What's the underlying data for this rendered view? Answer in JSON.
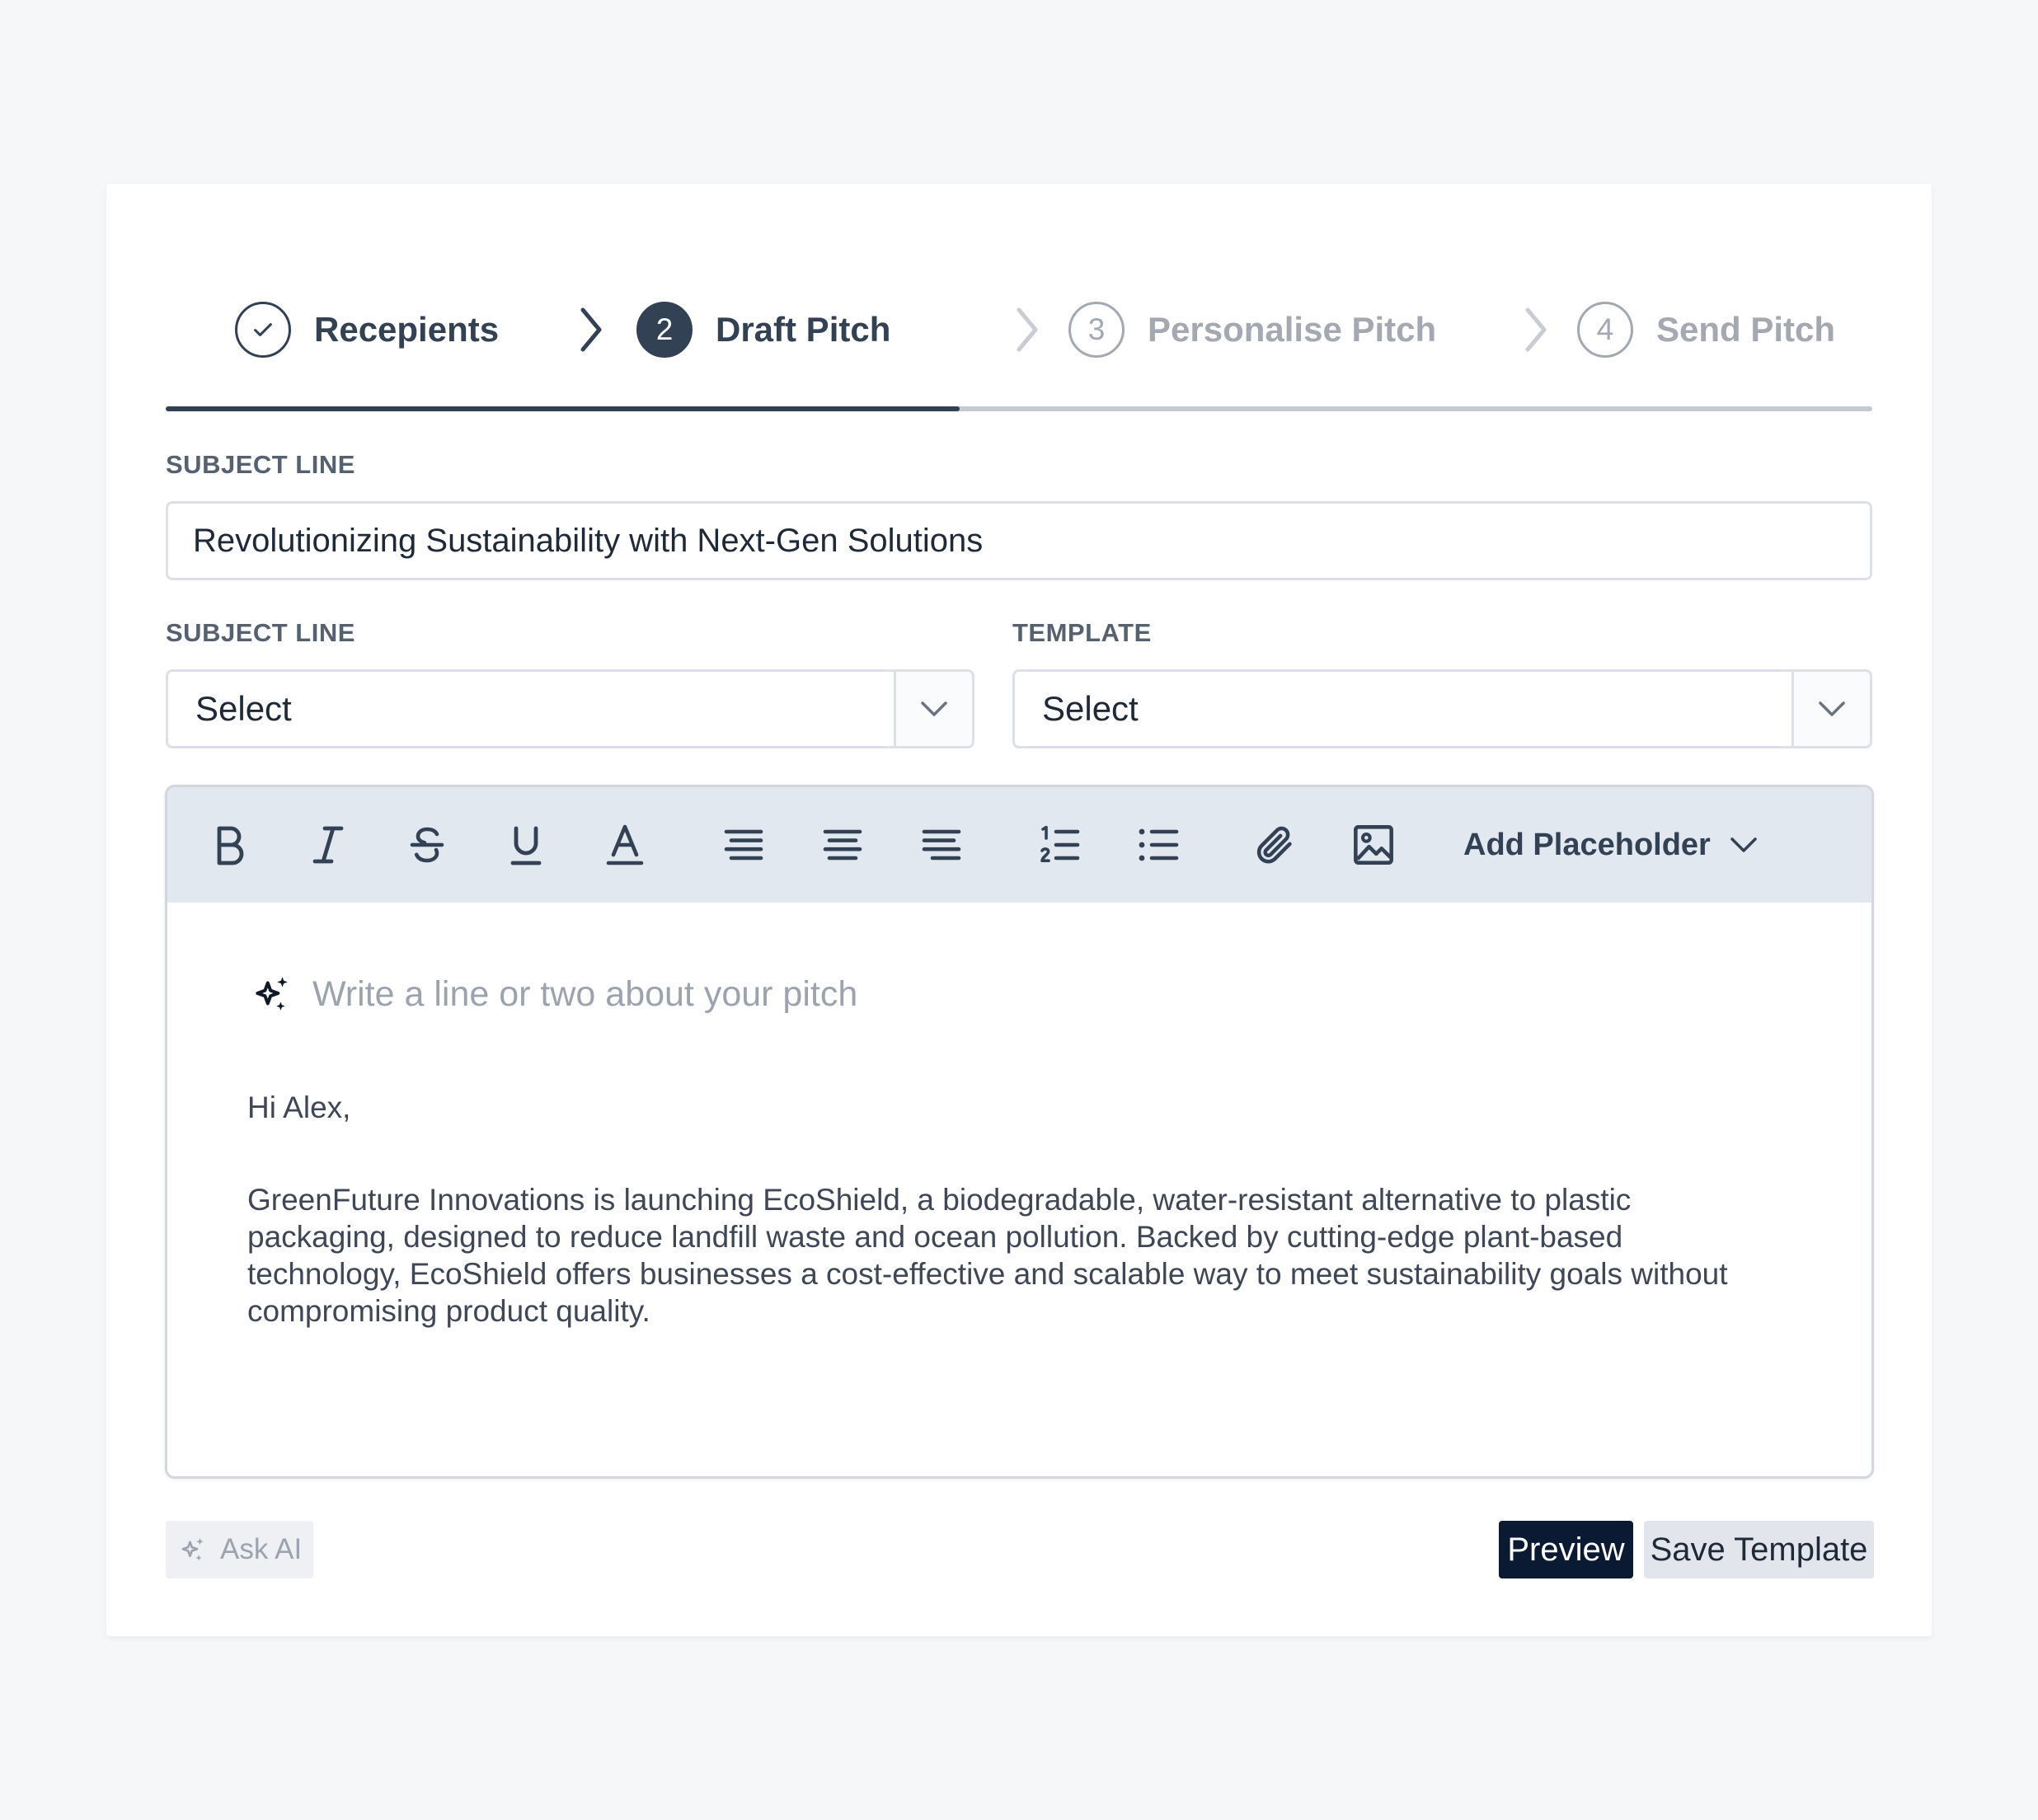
{
  "stepper": {
    "steps": [
      {
        "number": "",
        "label": "Recepients",
        "state": "completed",
        "icon": "check-icon"
      },
      {
        "number": "2",
        "label": "Draft Pitch",
        "state": "active"
      },
      {
        "number": "3",
        "label": "Personalise Pitch",
        "state": "upcoming"
      },
      {
        "number": "4",
        "label": "Send Pitch",
        "state": "upcoming"
      }
    ],
    "progress": 0.465
  },
  "subject": {
    "label": "SUBJECT LINE",
    "value": "Revolutionizing Sustainability with Next-Gen Solutions"
  },
  "subject_select": {
    "label": "SUBJECT LINE",
    "value": "Select"
  },
  "template_select": {
    "label": "TEMPLATE",
    "value": "Select"
  },
  "toolbar": {
    "icons": [
      "bold-icon",
      "italic-icon",
      "strikethrough-icon",
      "underline-icon",
      "text-color-icon",
      "align-left-icon",
      "align-center-icon",
      "align-right-icon",
      "ordered-list-icon",
      "bullet-list-icon",
      "attachment-icon",
      "image-icon"
    ],
    "placeholder_label": "Add Placeholder"
  },
  "editor": {
    "ai_placeholder": "Write a line or two about your pitch",
    "greeting": "Hi Alex,",
    "body": "GreenFuture Innovations is launching EcoShield, a biodegradable, water-resistant alternative to plastic packaging, designed to reduce landfill waste and ocean pollution. Backed by cutting-edge plant-based technology, EcoShield offers businesses a cost-effective and scalable way to meet sustainability goals without compromising product quality."
  },
  "footer": {
    "ask_ai_label": "Ask AI",
    "preview_label": "Preview",
    "save_label": "Save Template"
  },
  "colors": {
    "primary": "#334155",
    "muted": "#a3a8b1",
    "preview_button": "#0b1a33",
    "toolbar_bg": "#e2e8f0"
  }
}
